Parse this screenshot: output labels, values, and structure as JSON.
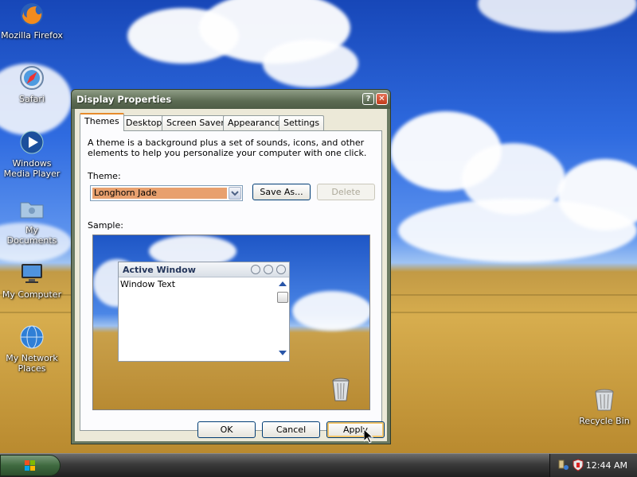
{
  "desktop": {
    "icons": [
      {
        "label": "Mozilla Firefox",
        "icon": "firefox-icon"
      },
      {
        "label": "Safari",
        "icon": "safari-compass-icon"
      },
      {
        "label": "Windows Media Player",
        "icon": "media-player-icon"
      },
      {
        "label": "My Documents",
        "icon": "folder-icon"
      },
      {
        "label": "My Computer",
        "icon": "monitor-icon"
      },
      {
        "label": "My Network Places",
        "icon": "globe-icon"
      },
      {
        "label": "Recycle Bin",
        "icon": "recycle-bin-icon"
      }
    ]
  },
  "dialog": {
    "title": "Display Properties",
    "help_glyph": "?",
    "close_glyph": "✕",
    "tabs": [
      "Themes",
      "Desktop",
      "Screen Saver",
      "Appearance",
      "Settings"
    ],
    "active_tab": "Themes",
    "description": "A theme is a background plus a set of sounds, icons, and other elements to help you personalize your computer with one click.",
    "theme_label": "Theme:",
    "theme_value": "Longhorn Jade",
    "save_as_label": "Save As...",
    "delete_label": "Delete",
    "sample_label": "Sample:",
    "ok_label": "OK",
    "cancel_label": "Cancel",
    "apply_label": "Apply"
  },
  "preview": {
    "active_window_title": "Active Window",
    "window_text": "Window Text"
  },
  "taskbar": {
    "clock": "12:44 AM"
  },
  "colors": {
    "accent_tab": "#e68b2c",
    "theme_highlight": "#e8a06e",
    "title_bar": "#5b6a52"
  }
}
